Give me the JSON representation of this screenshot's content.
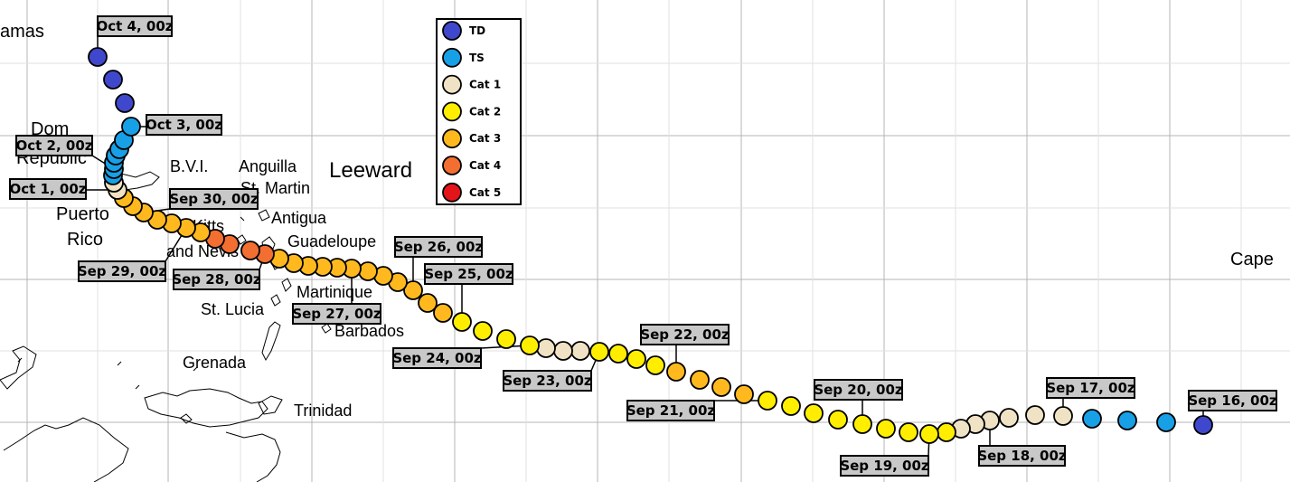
{
  "colors": {
    "TD": "#3f48cc",
    "TS": "#18a0e6",
    "Cat 1": "#f0e2c4",
    "Cat 2": "#ffee00",
    "Cat 3": "#ffb91e",
    "Cat 4": "#f36f31",
    "Cat 5": "#e3151a",
    "grid": "#b4b4b4",
    "label_bg": "#c8c8c8"
  },
  "legend": {
    "items": [
      "TD",
      "TS",
      "Cat 1",
      "Cat 2",
      "Cat 3",
      "Cat 4",
      "Cat 5"
    ]
  },
  "places": [
    {
      "id": "bahamas",
      "text": "amas"
    },
    {
      "id": "dom1",
      "text": "Dom"
    },
    {
      "id": "dom2",
      "text": "Republic"
    },
    {
      "id": "bvi",
      "text": "B.V.I."
    },
    {
      "id": "anguilla",
      "text": "Anguilla"
    },
    {
      "id": "stmartin",
      "text": "St. Martin"
    },
    {
      "id": "leeward",
      "text": "Leeward"
    },
    {
      "id": "pr1",
      "text": "Puerto"
    },
    {
      "id": "pr2",
      "text": "Rico"
    },
    {
      "id": "antigua",
      "text": "Antigua"
    },
    {
      "id": "skn1",
      "text": "St. Kitts"
    },
    {
      "id": "skn2",
      "text": "and Nevis"
    },
    {
      "id": "guadeloupe",
      "text": "Guadeloupe"
    },
    {
      "id": "martinique",
      "text": "Martinique"
    },
    {
      "id": "stlucia",
      "text": "St. Lucia"
    },
    {
      "id": "barbados",
      "text": "Barbados"
    },
    {
      "id": "grenada",
      "text": "Grenada"
    },
    {
      "id": "trinidad",
      "text": "Trinidad"
    },
    {
      "id": "cape",
      "text": "Cape"
    }
  ],
  "track": [
    "TD",
    "TS",
    "TS",
    "TS",
    "Cat 1",
    "Cat 1",
    "Cat 1",
    "Cat 1",
    "Cat 1",
    "Cat 1",
    "Cat 2",
    "Cat 2",
    "Cat 2",
    "Cat 2",
    "Cat 2",
    "Cat 2",
    "Cat 2",
    "Cat 2",
    "Cat 2",
    "Cat 3",
    "Cat 3",
    "Cat 3",
    "Cat 3",
    "Cat 2",
    "Cat 2",
    "Cat 2",
    "Cat 2",
    "Cat 1",
    "Cat 1",
    "Cat 1",
    "Cat 2",
    "Cat 2",
    "Cat 2",
    "Cat 2",
    "Cat 3",
    "Cat 3",
    "Cat 3",
    "Cat 3",
    "Cat 3",
    "Cat 3",
    "Cat 3",
    "Cat 3",
    "Cat 3",
    "Cat 3",
    "Cat 3",
    "Cat 3",
    "Cat 4",
    "Cat 4",
    "Cat 4",
    "Cat 4",
    "Cat 3",
    "Cat 3",
    "Cat 3",
    "Cat 3",
    "Cat 3",
    "Cat 3",
    "Cat 3",
    "Cat 1",
    "Cat 1",
    "TS",
    "TS",
    "TS",
    "TS",
    "TS",
    "TS",
    "TS",
    "TD",
    "TD",
    "TD"
  ],
  "date_labels": [
    {
      "text": "Sep 16, 00z",
      "point": 0
    },
    {
      "text": "Sep 17, 00z",
      "point": 4
    },
    {
      "text": "Sep 18, 00z",
      "point": 7
    },
    {
      "text": "Sep 19, 00z",
      "point": 11
    },
    {
      "text": "Sep 20, 00z",
      "point": 14
    },
    {
      "text": "Sep 21, 00z",
      "point": 18
    },
    {
      "text": "Sep 22, 00z",
      "point": 22
    },
    {
      "text": "Sep 23, 00z",
      "point": 26
    },
    {
      "text": "Sep 24, 00z",
      "point": 30
    },
    {
      "text": "Sep 25, 00z",
      "point": 33
    },
    {
      "text": "Sep 26, 00z",
      "point": 36
    },
    {
      "text": "Sep 27, 00z",
      "point": 40
    },
    {
      "text": "Sep 28, 00z",
      "point": 46
    },
    {
      "text": "Sep 29, 00z",
      "point": 51
    },
    {
      "text": "Sep 30, 00z",
      "point": 54
    },
    {
      "text": "Oct 1, 00z",
      "point": 57
    },
    {
      "text": "Oct 2, 00z",
      "point": 60
    },
    {
      "text": "Oct 3, 00z",
      "point": 65
    },
    {
      "text": "Oct 4, 00z",
      "point": 68
    }
  ]
}
